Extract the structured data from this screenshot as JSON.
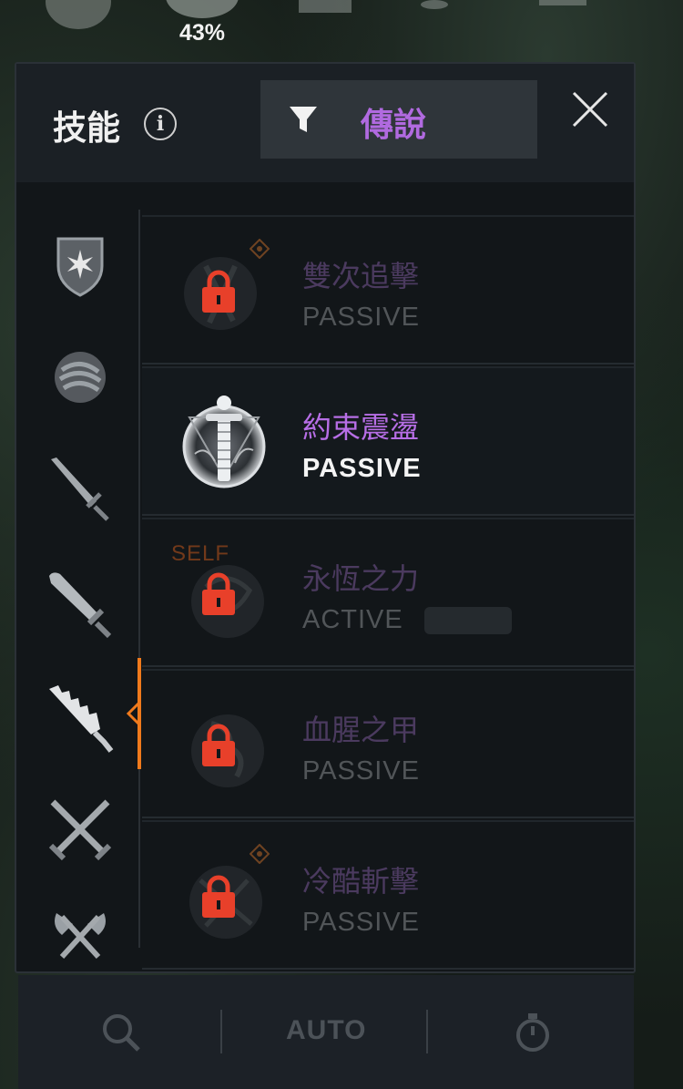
{
  "hud": {
    "progress_text": "43%"
  },
  "panel": {
    "title": "技能",
    "info_icon": "info-icon",
    "filter": {
      "icon": "filter-icon",
      "label": "傳說"
    },
    "close_icon": "close-icon"
  },
  "sidebar": {
    "categories": [
      {
        "name": "shield-category",
        "icon": "shield-icon",
        "selected": false
      },
      {
        "name": "gauntlet-category",
        "icon": "fist-icon",
        "selected": false
      },
      {
        "name": "sword-category",
        "icon": "sword-icon",
        "selected": false
      },
      {
        "name": "greatsword-category",
        "icon": "greatsword-icon",
        "selected": false
      },
      {
        "name": "serrated-blade-category",
        "icon": "serrated-blade-icon",
        "selected": true
      },
      {
        "name": "dual-swords-category",
        "icon": "crossed-swords-icon",
        "selected": false
      },
      {
        "name": "dual-axes-category",
        "icon": "crossed-axes-icon",
        "selected": false
      }
    ],
    "active_color": "#f07a1c"
  },
  "skills": [
    {
      "name": "雙次追擊",
      "type": "PASSIVE",
      "locked": true,
      "badge": true,
      "tag": ""
    },
    {
      "name": "約束震盪",
      "type": "PASSIVE",
      "locked": false,
      "badge": false,
      "tag": ""
    },
    {
      "name": "永恆之力",
      "type": "ACTIVE",
      "locked": true,
      "badge": false,
      "tag": "SELF"
    },
    {
      "name": "血腥之甲",
      "type": "PASSIVE",
      "locked": true,
      "badge": false,
      "tag": ""
    },
    {
      "name": "冷酷斬擊",
      "type": "PASSIVE",
      "locked": true,
      "badge": true,
      "tag": ""
    }
  ],
  "bottom_bar": {
    "search_icon": "search-icon",
    "auto_label": "AUTO",
    "timer_icon": "stopwatch-icon"
  },
  "colors": {
    "legendary_purple": "#b76ee6",
    "lock_red": "#e8402a",
    "accent_orange": "#f07a1c"
  }
}
